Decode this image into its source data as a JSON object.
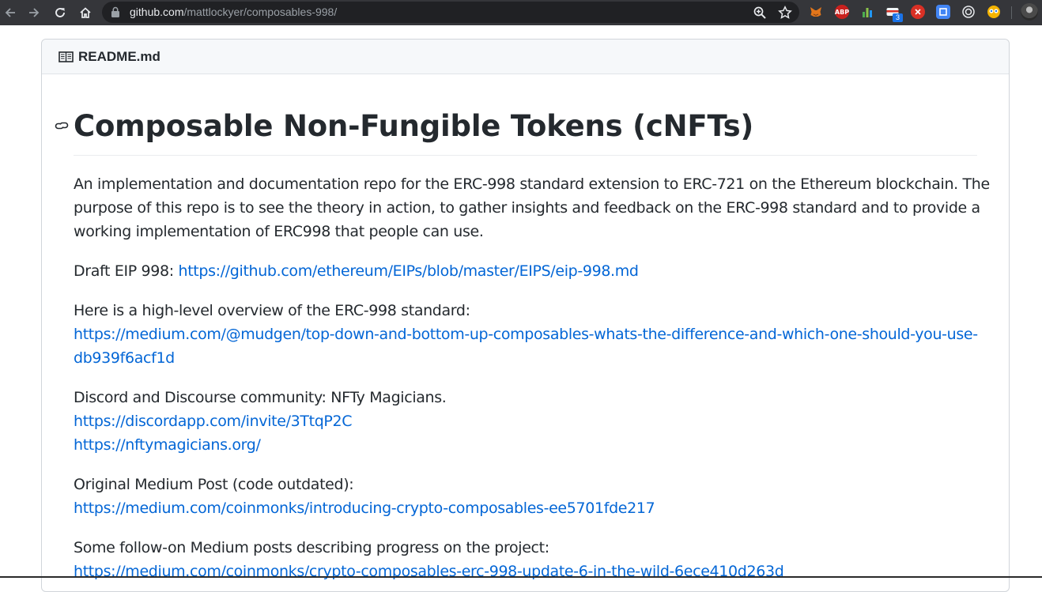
{
  "browser": {
    "url_host": "github.com",
    "url_path": "/mattlockyer/composables-998/",
    "extension_badge": "3",
    "abp_label": "ABP",
    "icons": [
      "back-icon",
      "forward-icon",
      "reload-icon",
      "home-icon",
      "lock-icon",
      "zoom-icon",
      "bookmark-star-icon"
    ]
  },
  "readme": {
    "filename": "README.md",
    "title": "Composable Non-Fungible Tokens (cNFTs)",
    "intro_line1": "An implementation and documentation repo for the ERC-998 standard extension to ERC-721 on the Ethereum blockchain. The",
    "intro_line2": "purpose of this repo is to see the theory in action, to gather insights and feedback on the ERC-998 standard and to provide a",
    "intro_line3": "working implementation of ERC998 that people can use.",
    "draft_label": "Draft EIP 998: ",
    "draft_link": "https://github.com/ethereum/EIPs/blob/master/EIPS/eip-998.md",
    "overview_label": "Here is a high-level overview of the ERC-998 standard:",
    "overview_link_line1": "https://medium.com/@mudgen/top-down-and-bottom-up-composables-whats-the-difference-and-which-one-should-you-use-",
    "overview_link_line2": "db939f6acf1d",
    "community_label": "Discord and Discourse community: NFTy Magicians.",
    "discord_link": "https://discordapp.com/invite/3TtqP2C",
    "nfty_link": "https://nftymagicians.org/",
    "original_label": "Original Medium Post (code outdated):",
    "original_link": "https://medium.com/coinmonks/introducing-crypto-composables-ee5701fde217",
    "followon_label": "Some follow-on Medium posts describing progress on the project:",
    "followon_link": "https://medium.com/coinmonks/crypto-composables-erc-998-update-6-in-the-wild-6ece410d263d"
  },
  "colors": {
    "link": "#0366d6",
    "text": "#24292e",
    "toolbar": "#35363a",
    "header_bg": "#f6f8fa"
  }
}
